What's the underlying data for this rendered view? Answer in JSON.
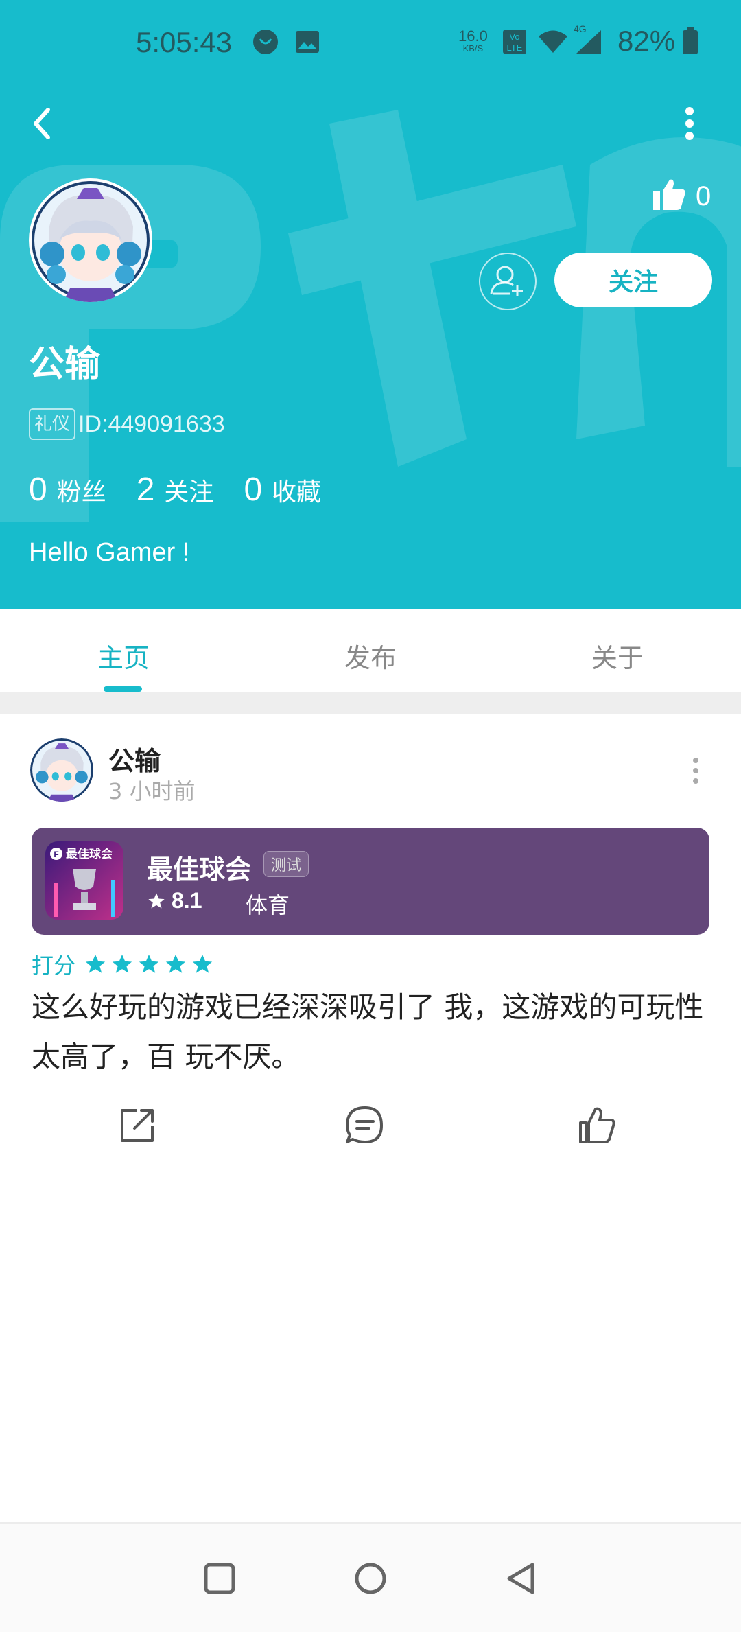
{
  "status_bar": {
    "time": "5:05:43",
    "net_speed_value": "16.0",
    "net_speed_unit": "KB/S",
    "network": "4G",
    "battery": "82%"
  },
  "header": {
    "like_count": "0",
    "follow_label": "关注",
    "username": "公输",
    "tag": "礼仪",
    "user_id": "ID:449091633",
    "stats": [
      {
        "num": "0",
        "label": "粉丝"
      },
      {
        "num": "2",
        "label": "关注"
      },
      {
        "num": "0",
        "label": "收藏"
      }
    ],
    "bio": "Hello Gamer !"
  },
  "tabs": [
    {
      "label": "主页",
      "active": true
    },
    {
      "label": "发布",
      "active": false
    },
    {
      "label": "关于",
      "active": false
    }
  ],
  "post": {
    "author": "公输",
    "time": "3 小时前",
    "game": {
      "title": "最佳球会",
      "badge": "测试",
      "rating": "8.1",
      "genre": "体育",
      "icon_text": "最佳球会"
    },
    "rate_label": "打分",
    "stars": 5,
    "text": "这么好玩的游戏已经深深吸引了 我，这游戏的可玩性太高了，百 玩不厌。"
  },
  "colors": {
    "header_bg": "#17bccc",
    "accent": "#17b3c3",
    "game_card_bg": "#64477a"
  }
}
